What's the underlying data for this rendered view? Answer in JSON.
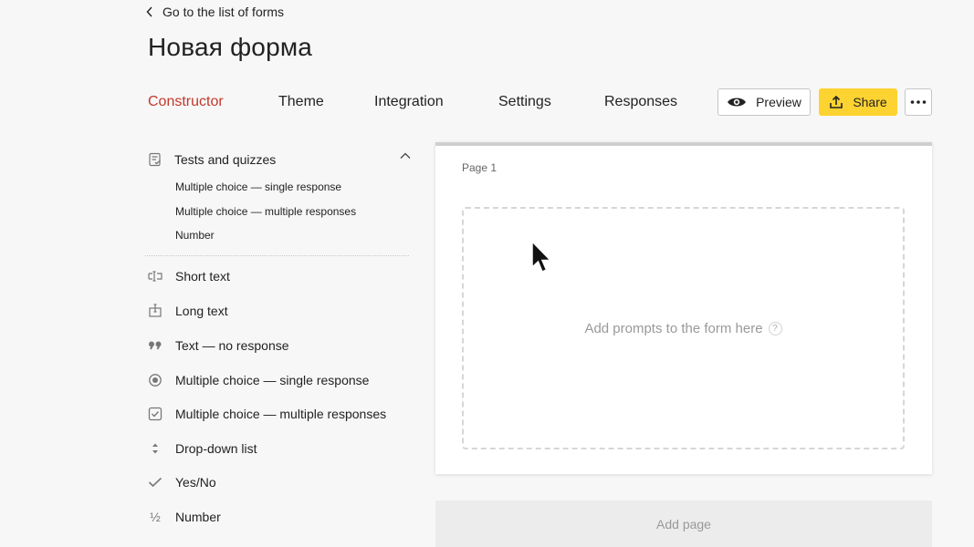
{
  "nav": {
    "back_label": "Go to the list of forms"
  },
  "form": {
    "title": "Новая форма"
  },
  "tabs": [
    {
      "label": "Constructor",
      "active": true
    },
    {
      "label": "Theme",
      "active": false
    },
    {
      "label": "Integration",
      "active": false
    },
    {
      "label": "Settings",
      "active": false
    },
    {
      "label": "Responses",
      "active": false
    }
  ],
  "actions": {
    "preview_label": "Preview",
    "share_label": "Share",
    "more_icon": "ellipsis-icon"
  },
  "sidebar": {
    "group": {
      "label": "Tests and quizzes",
      "expanded": true,
      "items": [
        {
          "label": "Multiple choice — single response"
        },
        {
          "label": "Multiple choice — multiple responses"
        },
        {
          "label": "Number"
        }
      ]
    },
    "items": [
      {
        "label": "Short text",
        "icon": "short-text-icon"
      },
      {
        "label": "Long text",
        "icon": "long-text-icon"
      },
      {
        "label": "Text — no response",
        "icon": "quote-icon"
      },
      {
        "label": "Multiple choice — single response",
        "icon": "radio-icon"
      },
      {
        "label": "Multiple choice — multiple responses",
        "icon": "checkbox-icon"
      },
      {
        "label": "Drop-down list",
        "icon": "updown-icon"
      },
      {
        "label": "Yes/No",
        "icon": "check-icon"
      },
      {
        "label": "Number",
        "icon": "fraction-icon"
      }
    ]
  },
  "canvas": {
    "page_label": "Page 1",
    "drop_prompt": "Add prompts to the form here",
    "help_symbol": "?",
    "add_page_label": "Add page"
  },
  "colors": {
    "accent": "#c0392b",
    "share_button": "#fdd331",
    "background": "#f7f7f7"
  }
}
